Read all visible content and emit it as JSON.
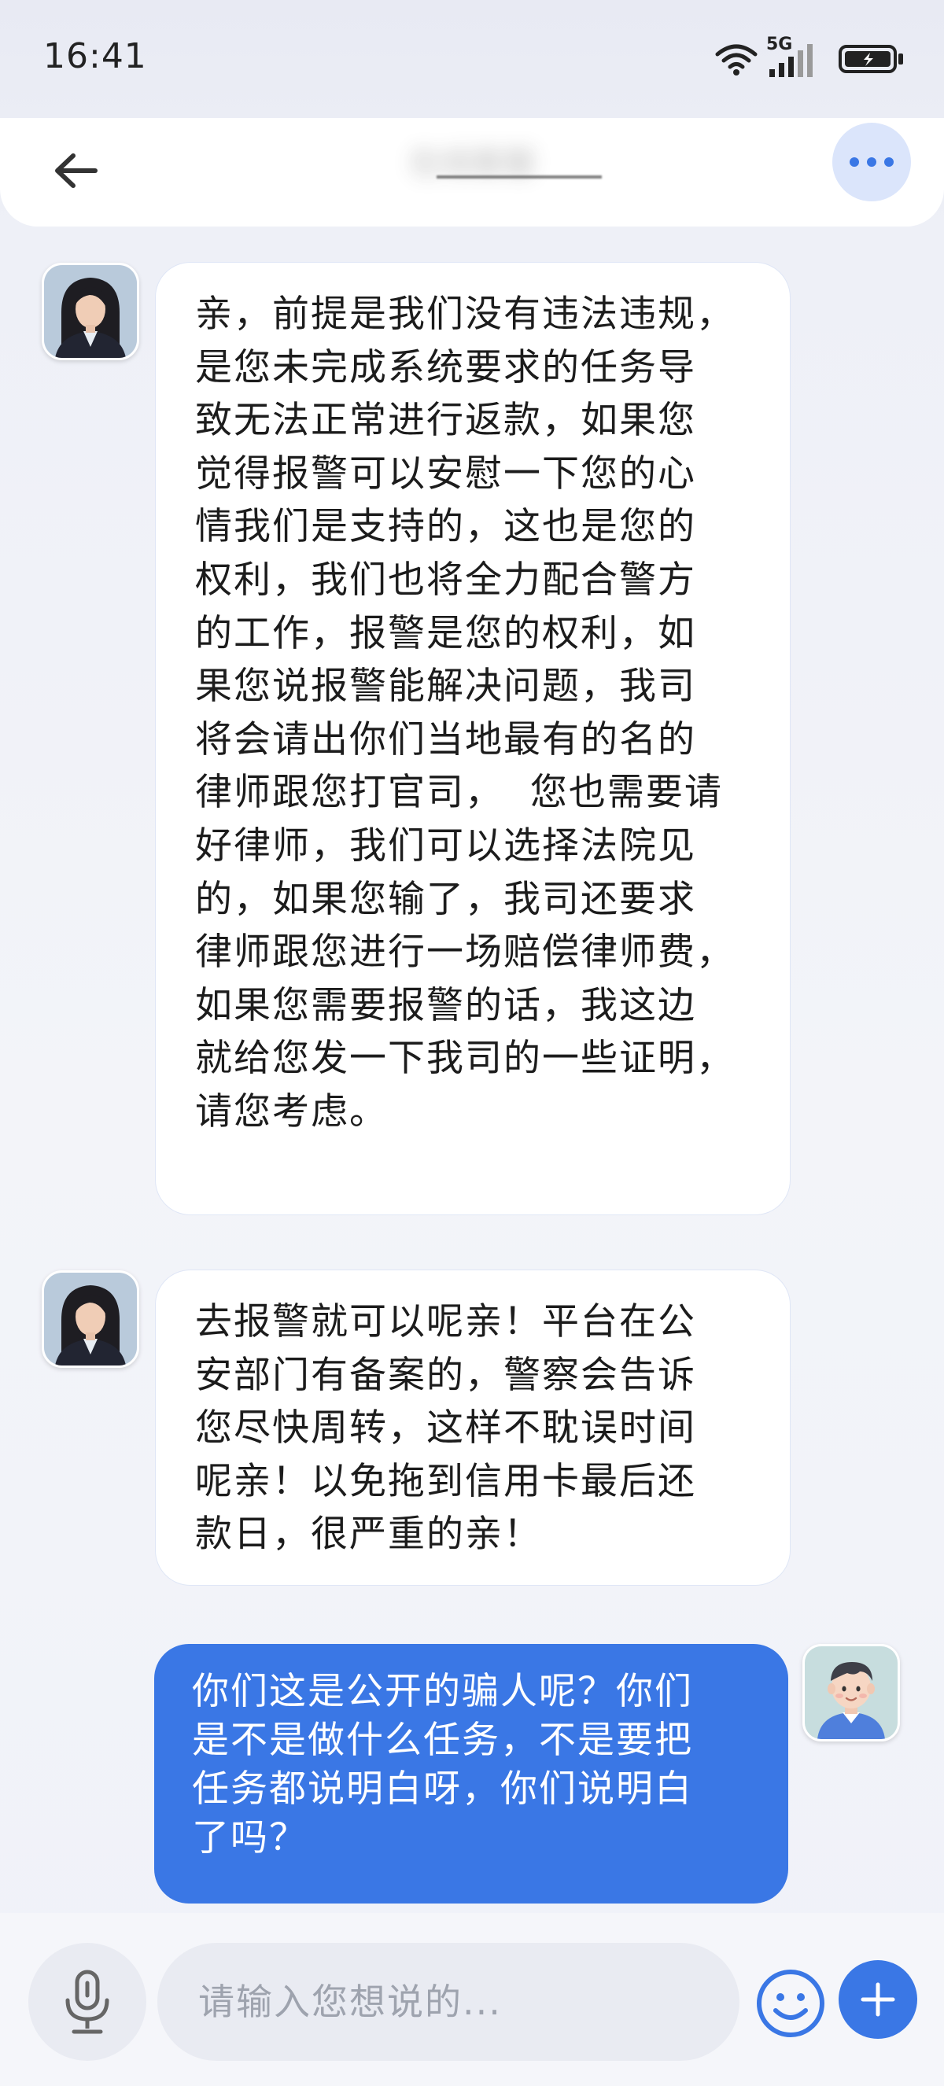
{
  "status_bar": {
    "time": "16:41",
    "network": "5G"
  },
  "header": {
    "title": "在线客服",
    "back_icon": "arrow-left-icon",
    "more_icon": "more-horizontal-icon"
  },
  "messages": [
    {
      "sender": "agent",
      "text": "亲，前提是我们没有违法违规，\n是您未完成系统要求的任务导\n致无法正常进行返款，如果您\n觉得报警可以安慰一下您的心\n情我们是支持的，这也是您的\n权利，我们也将全力配合警方\n的工作，报警是您的权利，如\n果您说报警能解决问题，我司\n将会请出你们当地最有的名的\n律师跟您打官司，  您也需要请\n好律师，我们可以选择法院见\n的，如果您输了，我司还要求\n律师跟您进行一场赔偿律师费，\n如果您需要报警的话，我这边\n就给您发一下我司的一些证明，\n请您考虑。"
    },
    {
      "sender": "agent",
      "text": "去报警就可以呢亲！平台在公\n安部门有备案的，警察会告诉\n您尽快周转，这样不耽误时间\n呢亲！以免拖到信用卡最后还\n款日，很严重的亲！"
    },
    {
      "sender": "user",
      "text": "你们这是公开的骗人呢？你们\n是不是做什么任务，不是要把\n任务都说明白呀，你们说明白\n了吗？"
    }
  ],
  "input_bar": {
    "placeholder": "请输入您想说的...",
    "mic_icon": "microphone-icon",
    "emoji_icon": "smiley-icon",
    "add_icon": "plus-icon"
  },
  "colors": {
    "accent": "#3a77e5",
    "bubble_in": "#ffffff",
    "background": "#eef0f7"
  }
}
